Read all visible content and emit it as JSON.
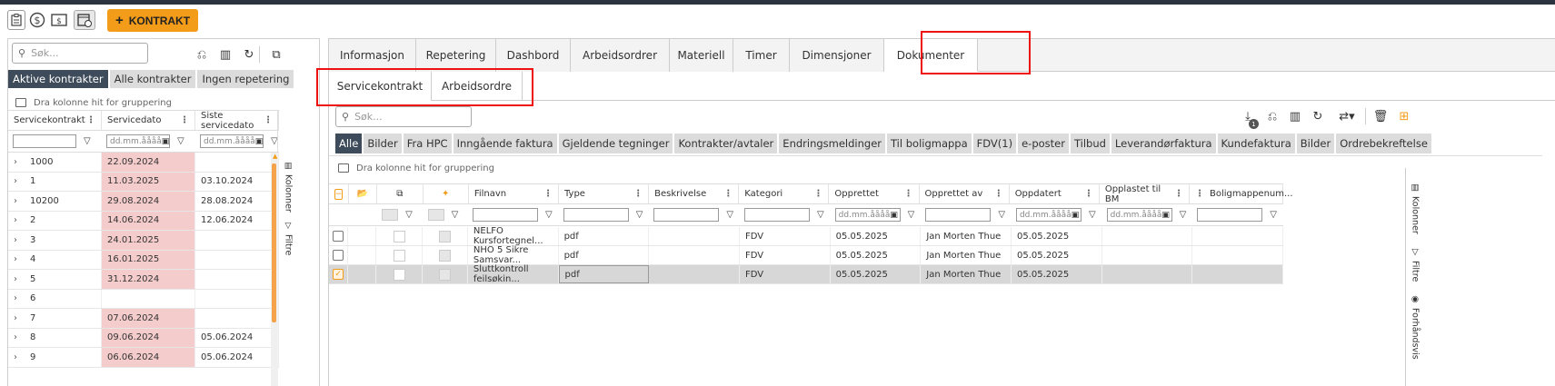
{
  "toolbar": {
    "kontrakt_button": "KONTRAKT",
    "kontrakt_plus": "+",
    "icons": [
      "clipboard-icon",
      "dollar-circle-icon",
      "dollar-bill-icon",
      "calendar-refresh-icon"
    ]
  },
  "left": {
    "search_placeholder": "Søk...",
    "tabs": [
      "Aktive kontrakter",
      "Alle kontrakter",
      "Ingen repetering"
    ],
    "group_hint": "Dra kolonne hit for gruppering",
    "columns": [
      "Servicekontrakt",
      "Servicedato",
      "Siste servicedato"
    ],
    "date_placeholder": "dd.mm.åååå",
    "rows": [
      {
        "id": "1000",
        "servicedato": "22.09.2024",
        "siste": ""
      },
      {
        "id": "1",
        "servicedato": "11.03.2025",
        "siste": "03.10.2024"
      },
      {
        "id": "10200",
        "servicedato": "29.08.2024",
        "siste": "28.08.2024"
      },
      {
        "id": "2",
        "servicedato": "14.06.2024",
        "siste": "12.06.2024"
      },
      {
        "id": "3",
        "servicedato": "24.01.2025",
        "siste": ""
      },
      {
        "id": "4",
        "servicedato": "16.01.2025",
        "siste": ""
      },
      {
        "id": "5",
        "servicedato": "31.12.2024",
        "siste": ""
      },
      {
        "id": "6",
        "servicedato": "",
        "siste": ""
      },
      {
        "id": "7",
        "servicedato": "07.06.2024",
        "siste": ""
      },
      {
        "id": "8",
        "servicedato": "09.06.2024",
        "siste": "05.06.2024"
      },
      {
        "id": "9",
        "servicedato": "06.06.2024",
        "siste": "05.06.2024"
      }
    ],
    "side_kolonner": "Kolonner",
    "side_filtre": "Filtre"
  },
  "main": {
    "tabs": [
      "Informasjon",
      "Repetering",
      "Dashbord",
      "Arbeidsordrer",
      "Materiell",
      "Timer",
      "Dimensjoner",
      "Dokumenter"
    ],
    "subtabs": [
      "Servicekontrakt",
      "Arbeidsordre"
    ],
    "search_placeholder": "Søk...",
    "download_badge": "1",
    "categories": [
      "Alle",
      "Bilder",
      "Fra HPC",
      "Inngående faktura",
      "Gjeldende tegninger",
      "Kontrakter/avtaler",
      "Endringsmeldinger",
      "Til boligmappa",
      "FDV(1)",
      "e-poster",
      "Tilbud",
      "Leverandørfaktura",
      "Kundefaktura",
      "Bilder",
      "Ordrebekreftelse"
    ],
    "group_hint": "Dra kolonne hit for gruppering",
    "columns": [
      "Filnavn",
      "Type",
      "Beskrivelse",
      "Kategori",
      "Opprettet",
      "Opprettet av",
      "Oppdatert",
      "Opplastet til BM",
      "Boligmappenum..."
    ],
    "date_placeholder": "dd.mm.åååå",
    "rows": [
      {
        "filnavn": "NELFO Kursfortegnel...",
        "type": "pdf",
        "beskrivelse": "",
        "kategori": "FDV",
        "opprettet": "05.05.2025",
        "av": "Jan Morten Thue",
        "oppdatert": "05.05.2025",
        "selected": false
      },
      {
        "filnavn": "NHO 5 Sikre Samsvar...",
        "type": "pdf",
        "beskrivelse": "",
        "kategori": "FDV",
        "opprettet": "05.05.2025",
        "av": "Jan Morten Thue",
        "oppdatert": "05.05.2025",
        "selected": false
      },
      {
        "filnavn": "Sluttkontroll feilsøkin...",
        "type": "pdf",
        "beskrivelse": "",
        "kategori": "FDV",
        "opprettet": "05.05.2025",
        "av": "Jan Morten Thue",
        "oppdatert": "05.05.2025",
        "selected": true
      }
    ],
    "side_kolonner": "Kolonner",
    "side_filtre": "Filtre",
    "side_forhandsvis": "Forhåndsvis"
  },
  "colors": {
    "accent": "#f39c1a",
    "active_tab": "#3d4b5a",
    "pink_cell": "#f5cccc",
    "highlight": "#e11"
  }
}
